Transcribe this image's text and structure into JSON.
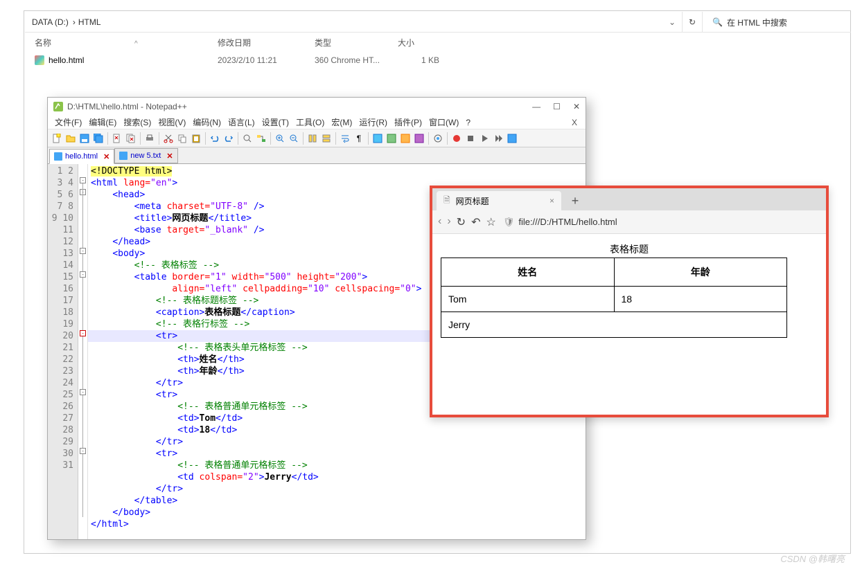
{
  "explorer": {
    "breadcrumb": [
      "DATA (D:)",
      "HTML"
    ],
    "search_placeholder": "在 HTML 中搜索",
    "columns": {
      "name": "名称",
      "date": "修改日期",
      "type": "类型",
      "size": "大小"
    },
    "files": [
      {
        "name": "hello.html",
        "date": "2023/2/10 11:21",
        "type": "360 Chrome HT...",
        "size": "1 KB"
      }
    ]
  },
  "npp": {
    "title": "D:\\HTML\\hello.html - Notepad++",
    "menus": [
      "文件(F)",
      "编辑(E)",
      "搜索(S)",
      "视图(V)",
      "编码(N)",
      "语言(L)",
      "设置(T)",
      "工具(O)",
      "宏(M)",
      "运行(R)",
      "插件(P)",
      "窗口(W)",
      "?"
    ],
    "tabs": [
      {
        "label": "hello.html",
        "active": true
      },
      {
        "label": "new 5.txt",
        "active": false
      }
    ],
    "lines": 31,
    "code_tokens": {
      "doctype": "<!DOCTYPE html>",
      "title_text": "网页标题",
      "caption_text": "表格标题",
      "th_name": "姓名",
      "th_age": "年龄",
      "td_tom": "Tom",
      "td_18": "18",
      "td_jerry": "Jerry",
      "cmt_table": "<!-- 表格标签 -->",
      "cmt_caption": "<!-- 表格标题标签 -->",
      "cmt_row": "<!-- 表格行标签 -->",
      "cmt_th": "<!-- 表格表头单元格标签 -->",
      "cmt_td": "<!-- 表格普通单元格标签 -->"
    }
  },
  "browser": {
    "tab_title": "网页标题",
    "url": "file:///D:/HTML/hello.html",
    "page": {
      "caption": "表格标题",
      "headers": [
        "姓名",
        "年龄"
      ],
      "rows": [
        {
          "cells": [
            "Tom",
            "18"
          ]
        },
        {
          "cells": [
            "Jerry"
          ],
          "colspan": 2
        }
      ]
    }
  },
  "watermark": "CSDN @韩曙亮"
}
